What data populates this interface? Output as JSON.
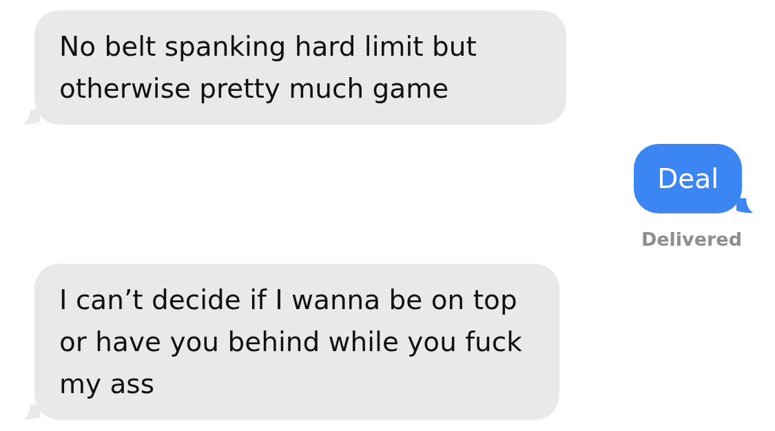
{
  "messages": [
    {
      "kind": "incoming",
      "text": "No belt spanking hard limit but otherwise pretty much game"
    },
    {
      "kind": "outgoing",
      "text": "Deal",
      "status": "Delivered"
    },
    {
      "kind": "incoming",
      "text": "I can’t decide if I wanna be on top or have you behind while you fuck my ass"
    }
  ]
}
